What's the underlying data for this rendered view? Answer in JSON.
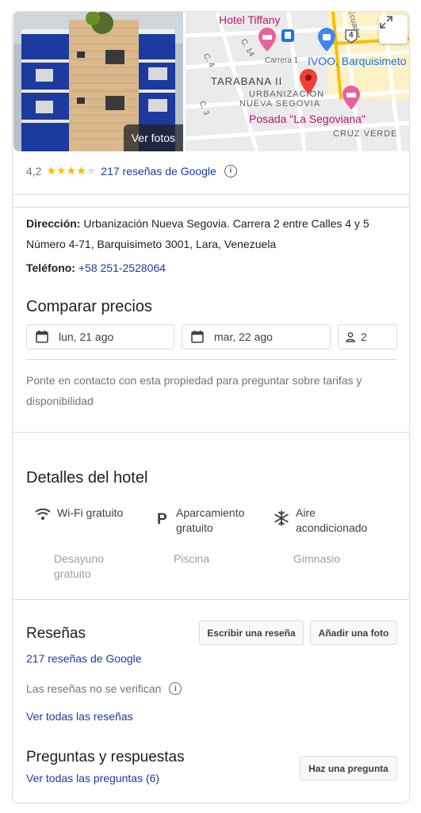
{
  "header": {
    "photos_label": "Ver fotos",
    "map_labels": {
      "hotel_tiffany": "Hotel Tiffany",
      "ivoo": "IVOO, Barquisimeto",
      "tarabana": "TARABANA II",
      "urbanizacion_1": "URBANIZACION",
      "urbanizacion_2": "NUEVA SEGOVIA",
      "posada": "Posada \"La Segoviana\"",
      "cruz_verde": "CRUZ VERDE",
      "carrera_1": "Carrera 1",
      "calle_14": "C. 14",
      "calle_4": "C. 4",
      "calle_3": "C. 3",
      "ecuador": "Ecuador",
      "route_4": "4"
    }
  },
  "rating": {
    "value": "4,2",
    "stars_filled": 4,
    "stars_total": 5,
    "reviews_link": "217 reseñas de Google"
  },
  "details": {
    "address_label": "Dirección:",
    "address_value": "Urbanización Nueva Segovia. Carrera 2 entre Calles 4 y 5 Número 4-71, Barquisimeto 3001, Lara, Venezuela",
    "phone_label": "Teléfono:",
    "phone_value": "+58 251-2528064"
  },
  "prices": {
    "title": "Comparar precios",
    "checkin": "lun, 21 ago",
    "checkout": "mar, 22 ago",
    "guests": "2",
    "note": "Ponte en contacto con esta propiedad para preguntar sobre tarifas y disponibilidad"
  },
  "hotel_details": {
    "title": "Detalles del hotel",
    "amenities": [
      {
        "icon": "wifi-icon",
        "label1": "Wi-Fi gratuito",
        "label2": ""
      },
      {
        "icon": "parking-icon",
        "label1": "Aparcamiento",
        "label2": "gratuito"
      },
      {
        "icon": "snowflake-icon",
        "label1": "Aire",
        "label2": "acondicionado"
      },
      {
        "icon": "",
        "label1": "Desayuno",
        "label2": "gratuito"
      },
      {
        "icon": "",
        "label1": "Piscina",
        "label2": ""
      },
      {
        "icon": "",
        "label1": "Gimnasio",
        "label2": ""
      }
    ]
  },
  "reviews": {
    "title": "Reseñas",
    "write_button": "Escribir una reseña",
    "photo_button": "Añadir una foto",
    "google_reviews_link": "217 reseñas de Google",
    "unverified_note": "Las reseñas no se verifican",
    "see_all": "Ver todas las reseñas"
  },
  "qa": {
    "title": "Preguntas y respuestas",
    "see_all": "Ver todas las preguntas (6)",
    "ask_button": "Haz una pregunta"
  },
  "colors": {
    "link": "#1a3da0",
    "star": "#fbbc04",
    "map_pin_red": "#ea4335",
    "map_pink": "#c5146a",
    "map_blue": "#1a73e8"
  }
}
